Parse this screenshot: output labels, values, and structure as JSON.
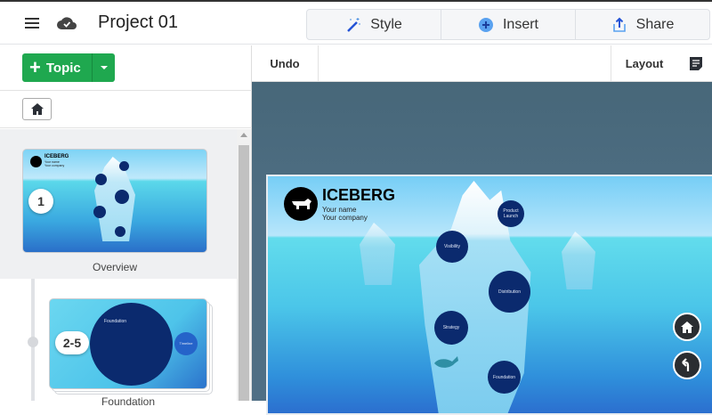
{
  "header": {
    "title": "Project 01",
    "style_label": "Style",
    "insert_label": "Insert",
    "share_label": "Share"
  },
  "sidebar": {
    "topic_label": "Topic",
    "items": [
      {
        "badge": "1",
        "label": "Overview",
        "thumb": {
          "title": "ICEBERG",
          "name": "Your name",
          "company": "Your company"
        }
      },
      {
        "badge": "2-5",
        "label": "Foundation",
        "thumb": {
          "big": "Foundation",
          "small": "Timeline"
        }
      }
    ]
  },
  "toolbar": {
    "undo_label": "Undo",
    "layout_label": "Layout"
  },
  "slide": {
    "title": "ICEBERG",
    "name": "Your name",
    "company": "Your company",
    "topics": [
      "Product Launch",
      "Visibility",
      "Distribution",
      "Strategy",
      "Foundation"
    ]
  },
  "colors": {
    "accent": "#1fa84f",
    "topic_circle": "#0b2a6e",
    "canvas": "#4a6a7f"
  }
}
